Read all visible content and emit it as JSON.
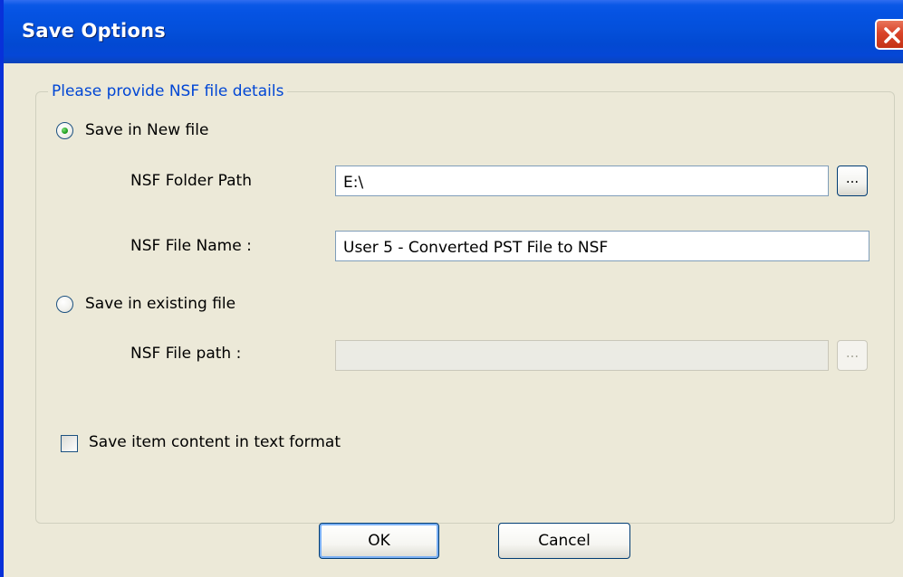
{
  "window": {
    "title": "Save Options"
  },
  "group": {
    "legend": "Please provide NSF file details"
  },
  "new_file": {
    "radio_label": "Save in New file",
    "selected": true,
    "folder_path_label": "NSF Folder Path",
    "folder_path_value": "E:\\",
    "file_name_label": "NSF File Name :",
    "file_name_value": "User 5 - Converted PST File to NSF",
    "browse_label": "..."
  },
  "existing_file": {
    "radio_label": "Save in existing file",
    "selected": false,
    "file_path_label": "NSF File path :",
    "file_path_value": "",
    "browse_label": "...",
    "enabled": false
  },
  "options": {
    "text_format_label": "Save item content in text format",
    "text_format_checked": false
  },
  "buttons": {
    "ok": "OK",
    "cancel": "Cancel"
  },
  "colors": {
    "titlebar": "#0450db",
    "legend_text": "#0046d5",
    "dialog_bg": "#ece9d8",
    "close_button": "#d9442a"
  }
}
